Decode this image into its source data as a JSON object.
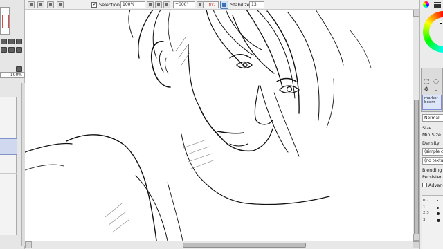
{
  "toolbar": {
    "selection_label": "Selection",
    "selection_checked": true,
    "zoom_value": "100%",
    "rotation_value": "+000°",
    "invert_label": "Inv.",
    "stabilizer_label": "Stabilizer",
    "stabilizer_value": "13"
  },
  "left_panel": {
    "zoom_value": "100%"
  },
  "right_panel": {
    "brush_name": "marker boom",
    "blend_mode": "Normal",
    "size_label": "Size",
    "min_size_label": "Min Size",
    "density_label": "Density",
    "texture_value": "(simple c",
    "texture2_value": "(no textu",
    "blending_label": "Blending",
    "persistence_label": "Persistence",
    "advanced_label": "Advanc",
    "scale": [
      "0.7",
      "1",
      "2.3",
      "3"
    ]
  },
  "colors": {
    "ui_bg": "#efefef",
    "selection_highlight": "#cfd8ef",
    "accent_blue": "#3c6fb5",
    "invert_red": "#c0392b"
  },
  "icons": {
    "menu": "menu-icon",
    "color_wheel": "color-wheel-icon",
    "stabilizer": "stabilizer-icon",
    "marquee": "marquee-icon",
    "lasso": "lasso-icon",
    "move": "move-icon",
    "zoom": "zoom-icon"
  }
}
